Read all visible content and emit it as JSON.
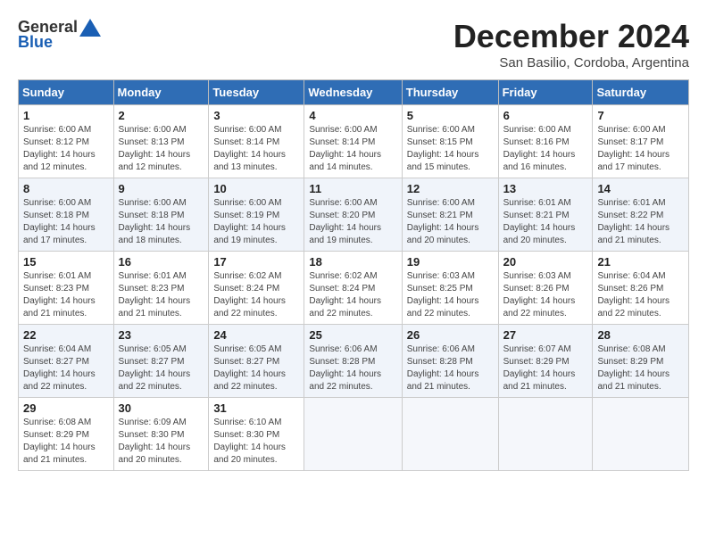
{
  "header": {
    "logo_general": "General",
    "logo_blue": "Blue",
    "title": "December 2024",
    "location": "San Basilio, Cordoba, Argentina"
  },
  "weekdays": [
    "Sunday",
    "Monday",
    "Tuesday",
    "Wednesday",
    "Thursday",
    "Friday",
    "Saturday"
  ],
  "weeks": [
    [
      {
        "day": "1",
        "info": "Sunrise: 6:00 AM\nSunset: 8:12 PM\nDaylight: 14 hours\nand 12 minutes."
      },
      {
        "day": "2",
        "info": "Sunrise: 6:00 AM\nSunset: 8:13 PM\nDaylight: 14 hours\nand 12 minutes."
      },
      {
        "day": "3",
        "info": "Sunrise: 6:00 AM\nSunset: 8:14 PM\nDaylight: 14 hours\nand 13 minutes."
      },
      {
        "day": "4",
        "info": "Sunrise: 6:00 AM\nSunset: 8:14 PM\nDaylight: 14 hours\nand 14 minutes."
      },
      {
        "day": "5",
        "info": "Sunrise: 6:00 AM\nSunset: 8:15 PM\nDaylight: 14 hours\nand 15 minutes."
      },
      {
        "day": "6",
        "info": "Sunrise: 6:00 AM\nSunset: 8:16 PM\nDaylight: 14 hours\nand 16 minutes."
      },
      {
        "day": "7",
        "info": "Sunrise: 6:00 AM\nSunset: 8:17 PM\nDaylight: 14 hours\nand 17 minutes."
      }
    ],
    [
      {
        "day": "8",
        "info": "Sunrise: 6:00 AM\nSunset: 8:18 PM\nDaylight: 14 hours\nand 17 minutes."
      },
      {
        "day": "9",
        "info": "Sunrise: 6:00 AM\nSunset: 8:18 PM\nDaylight: 14 hours\nand 18 minutes."
      },
      {
        "day": "10",
        "info": "Sunrise: 6:00 AM\nSunset: 8:19 PM\nDaylight: 14 hours\nand 19 minutes."
      },
      {
        "day": "11",
        "info": "Sunrise: 6:00 AM\nSunset: 8:20 PM\nDaylight: 14 hours\nand 19 minutes."
      },
      {
        "day": "12",
        "info": "Sunrise: 6:00 AM\nSunset: 8:21 PM\nDaylight: 14 hours\nand 20 minutes."
      },
      {
        "day": "13",
        "info": "Sunrise: 6:01 AM\nSunset: 8:21 PM\nDaylight: 14 hours\nand 20 minutes."
      },
      {
        "day": "14",
        "info": "Sunrise: 6:01 AM\nSunset: 8:22 PM\nDaylight: 14 hours\nand 21 minutes."
      }
    ],
    [
      {
        "day": "15",
        "info": "Sunrise: 6:01 AM\nSunset: 8:23 PM\nDaylight: 14 hours\nand 21 minutes."
      },
      {
        "day": "16",
        "info": "Sunrise: 6:01 AM\nSunset: 8:23 PM\nDaylight: 14 hours\nand 21 minutes."
      },
      {
        "day": "17",
        "info": "Sunrise: 6:02 AM\nSunset: 8:24 PM\nDaylight: 14 hours\nand 22 minutes."
      },
      {
        "day": "18",
        "info": "Sunrise: 6:02 AM\nSunset: 8:24 PM\nDaylight: 14 hours\nand 22 minutes."
      },
      {
        "day": "19",
        "info": "Sunrise: 6:03 AM\nSunset: 8:25 PM\nDaylight: 14 hours\nand 22 minutes."
      },
      {
        "day": "20",
        "info": "Sunrise: 6:03 AM\nSunset: 8:26 PM\nDaylight: 14 hours\nand 22 minutes."
      },
      {
        "day": "21",
        "info": "Sunrise: 6:04 AM\nSunset: 8:26 PM\nDaylight: 14 hours\nand 22 minutes."
      }
    ],
    [
      {
        "day": "22",
        "info": "Sunrise: 6:04 AM\nSunset: 8:27 PM\nDaylight: 14 hours\nand 22 minutes."
      },
      {
        "day": "23",
        "info": "Sunrise: 6:05 AM\nSunset: 8:27 PM\nDaylight: 14 hours\nand 22 minutes."
      },
      {
        "day": "24",
        "info": "Sunrise: 6:05 AM\nSunset: 8:27 PM\nDaylight: 14 hours\nand 22 minutes."
      },
      {
        "day": "25",
        "info": "Sunrise: 6:06 AM\nSunset: 8:28 PM\nDaylight: 14 hours\nand 22 minutes."
      },
      {
        "day": "26",
        "info": "Sunrise: 6:06 AM\nSunset: 8:28 PM\nDaylight: 14 hours\nand 21 minutes."
      },
      {
        "day": "27",
        "info": "Sunrise: 6:07 AM\nSunset: 8:29 PM\nDaylight: 14 hours\nand 21 minutes."
      },
      {
        "day": "28",
        "info": "Sunrise: 6:08 AM\nSunset: 8:29 PM\nDaylight: 14 hours\nand 21 minutes."
      }
    ],
    [
      {
        "day": "29",
        "info": "Sunrise: 6:08 AM\nSunset: 8:29 PM\nDaylight: 14 hours\nand 21 minutes."
      },
      {
        "day": "30",
        "info": "Sunrise: 6:09 AM\nSunset: 8:30 PM\nDaylight: 14 hours\nand 20 minutes."
      },
      {
        "day": "31",
        "info": "Sunrise: 6:10 AM\nSunset: 8:30 PM\nDaylight: 14 hours\nand 20 minutes."
      },
      {
        "day": "",
        "info": ""
      },
      {
        "day": "",
        "info": ""
      },
      {
        "day": "",
        "info": ""
      },
      {
        "day": "",
        "info": ""
      }
    ]
  ]
}
